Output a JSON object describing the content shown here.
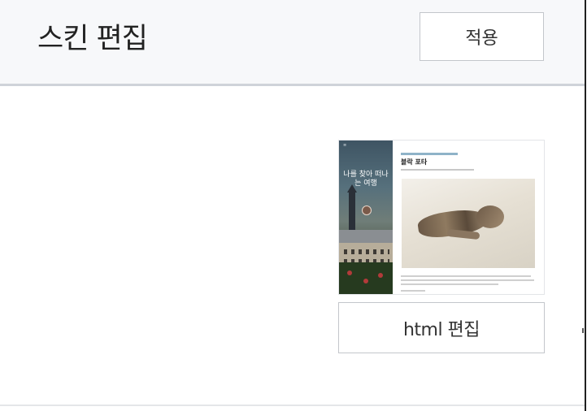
{
  "header": {
    "title": "스킨 편집",
    "apply_label": "적용"
  },
  "preview": {
    "sidebar_title": "나를 찾아 떠나는 여행",
    "post_title": "블락 포타"
  },
  "actions": {
    "edit_html_label": "html 편집"
  },
  "colors": {
    "header_bg": "#f7f8fa",
    "border": "#c3c6cb",
    "text": "#222222"
  }
}
